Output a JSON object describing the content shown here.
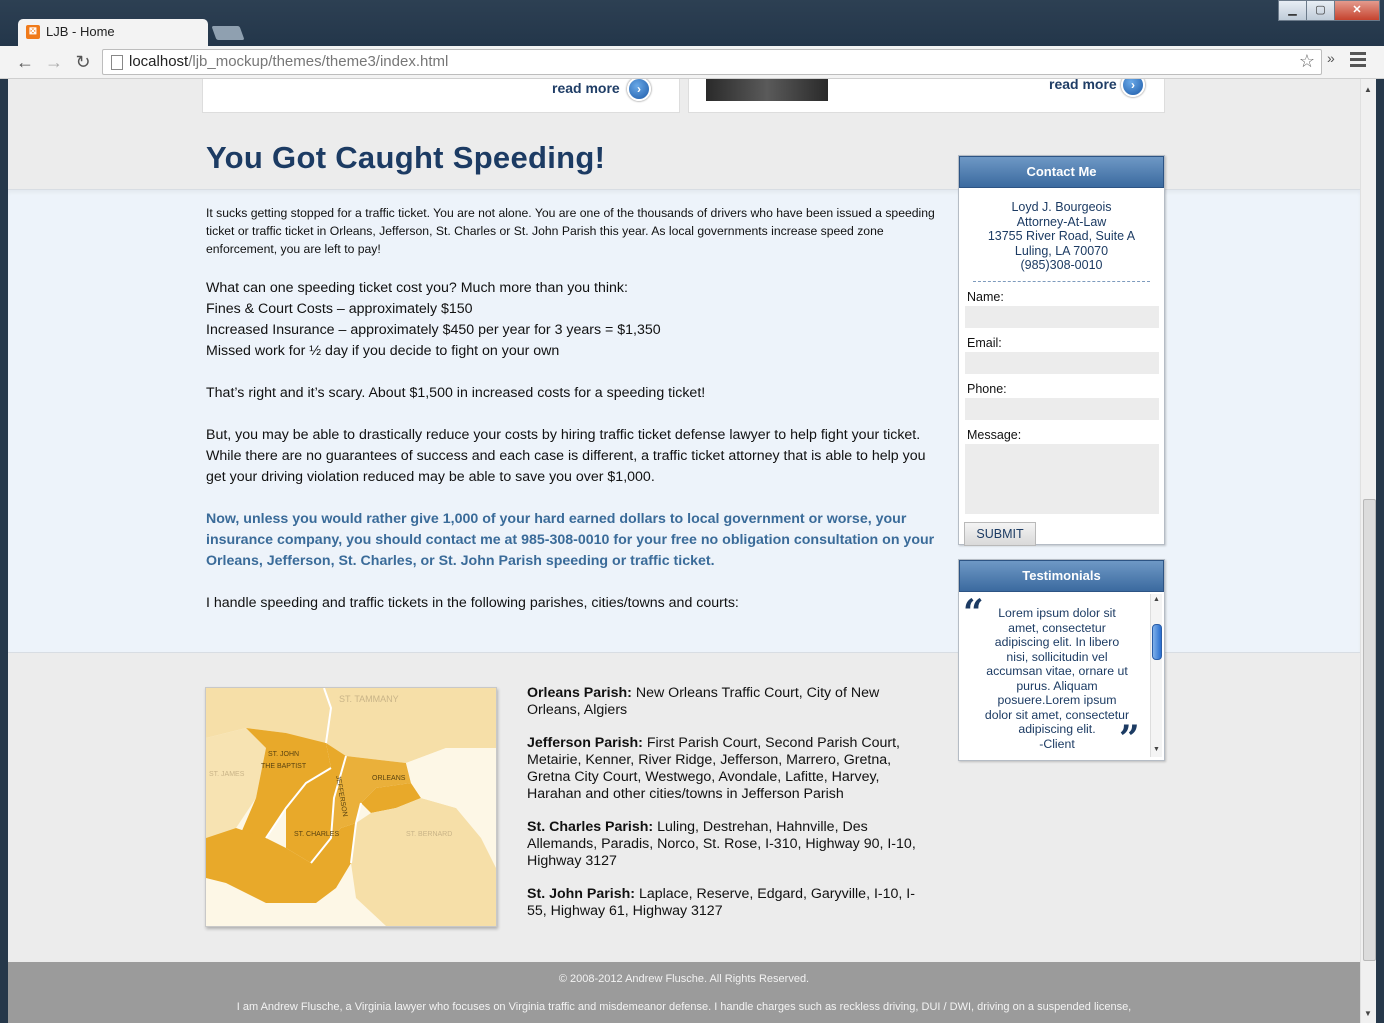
{
  "browser": {
    "tab_title": "LJB - Home",
    "url_host": "localhost",
    "url_path": "/ljb_mockup/themes/theme3/index.html"
  },
  "cards": {
    "read_more_left": "read more",
    "read_more_right": "read more"
  },
  "article": {
    "headline": "You Got Caught Speeding!",
    "intro": "It sucks getting stopped for a traffic ticket.  You are not alone.  You are one of the thousands of drivers who have been issued a speeding ticket or traffic ticket in Orleans, Jefferson, St. Charles or St. John Parish this year.  As local governments increase speed zone enforcement, you are left to pay!",
    "cost_lines": [
      "What can one speeding ticket cost you?  Much more than you think:",
      "Fines & Court Costs – approximately $150",
      "Increased Insurance – approximately $450 per year for 3 years = $1,350",
      "Missed work for ½ day if you decide to fight on your own"
    ],
    "scary": "That’s right and it’s scary.  About $1,500 in increased costs for a speeding ticket!",
    "reduce": "But, you may be able to drastically reduce your costs by hiring traffic ticket defense lawyer to help fight your ticket.  While there are no guarantees of success and each case is different, a traffic ticket attorney that is able to help you get your driving violation reduced may be able to save you over $1,000.",
    "cta": "Now, unless you would rather give 1,000 of your hard earned dollars to local government or worse, your insurance company, you should contact me at 985-308-0010 for your free no obligation consultation on your Orleans, Jefferson, St. Charles, or St. John Parish speeding or traffic ticket.",
    "handle": "I handle speeding and traffic tickets in the following parishes, cities/towns and courts:"
  },
  "contact": {
    "title": "Contact Me",
    "name": "Loyd J. Bourgeois",
    "role": "Attorney-At-Law",
    "address1": "13755 River Road, Suite A",
    "address2": "Luling, LA 70070",
    "phone": "(985)308-0010",
    "label_name": "Name:",
    "label_email": "Email:",
    "label_phone": "Phone:",
    "label_message": "Message:",
    "submit": "SUBMIT"
  },
  "testimonials": {
    "title": "Testimonials",
    "text": "Lorem ipsum dolor sit amet, consectetur adipiscing elit. In libero nisi, sollicitudin vel accumsan vitae, ornare ut purus. Aliquam posuere.Lorem ipsum dolor sit amet, consectetur adipiscing elit.",
    "author": "-Client"
  },
  "map_labels": {
    "st_tammany": "ST. TAMMANY",
    "st_james": "ST. JAMES",
    "st_john_1": "ST. JOHN",
    "st_john_2": "THE BAPTIST",
    "jefferson": "JEFFERSON",
    "orleans": "ORLEANS",
    "st_charles": "ST. CHARLES",
    "st_bernard": "ST. BERNARD"
  },
  "parishes": [
    {
      "name": "Orleans Parish:",
      "courts": "New Orleans Traffic Court, City of New Orleans, Algiers"
    },
    {
      "name": "Jefferson Parish:",
      "courts": "First Parish Court, Second Parish Court, Metairie, Kenner, River Ridge, Jefferson, Marrero, Gretna, Gretna City Court, Westwego, Avondale, Lafitte, Harvey, Harahan and other cities/towns in Jefferson Parish"
    },
    {
      "name": "St. Charles Parish:",
      "courts": "Luling, Destrehan, Hahnville, Des Allemands, Paradis, Norco, St. Rose, I-310, Highway 90, I-10, Highway 3127"
    },
    {
      "name": "St. John Parish:",
      "courts": "Laplace, Reserve, Edgard, Garyville, I-10, I-55, Highway 61, Highway 3127"
    }
  ],
  "footer": {
    "copyright": "© 2008-2012 Andrew Flusche. All Rights Reserved.",
    "about": "I am Andrew Flusche, a Virginia lawyer who focuses on Virginia traffic and misdemeanor defense. I handle charges such as reckless driving, DUI / DWI, driving on a suspended license,"
  },
  "colors": {
    "headline": "#1c3b63",
    "accent_blue": "#3a6b99",
    "orange_parish": "#e8a92a",
    "light_parish": "#f6dfa8"
  }
}
